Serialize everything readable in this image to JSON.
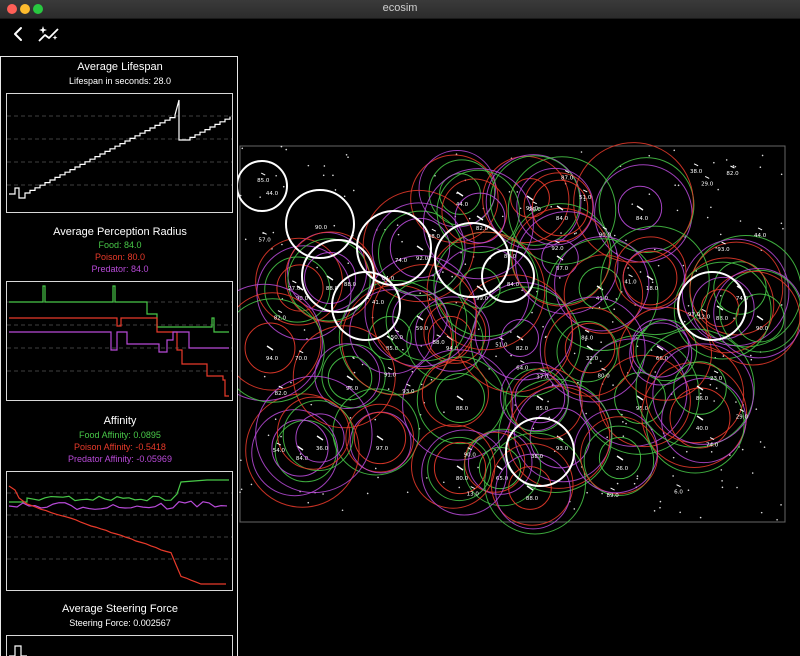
{
  "window": {
    "title": "ecosim"
  },
  "toolbar": {
    "back_icon": "chevron-left-icon",
    "stats_icon": "sparkle-chart-icon"
  },
  "colors": {
    "food": "#48c848",
    "poison": "#e83a2a",
    "predator": "#b84ad8",
    "white": "#ffffff"
  },
  "panel": {
    "lifespan": {
      "title": "Average Lifespan",
      "subtitle": "Lifespan in seconds: 28.0"
    },
    "perception": {
      "title": "Average Perception Radius",
      "food": "Food: 84.0",
      "poison": "Poison: 80.0",
      "predator": "Predator: 84.0"
    },
    "affinity": {
      "title": "Affinity",
      "food": "Food Affinity: 0.0895",
      "poison": "Poison Affinity: -0.5418",
      "predator": "Predator Affinity: -0.05969"
    },
    "steering": {
      "title": "Average Steering Force",
      "subtitle": "Steering Force: 0.002567"
    }
  },
  "simulation": {
    "creature_labels": [
      "44.0",
      "90.0",
      "84.0",
      "74.0",
      "88.0",
      "87.0",
      "41.0",
      "90.0",
      "88.0",
      "85.0",
      "94.0",
      "82.0",
      "95.0",
      "40.0",
      "93.0",
      "88.0",
      "97.0",
      "84.0",
      "65.0",
      "88.0",
      "92.0",
      "99.0",
      "32.0",
      "68.0",
      "96.0",
      "80.0",
      "85.0",
      "26.0",
      "94.0",
      "36.0",
      "86.0",
      "84.0",
      "59.0",
      "90.0",
      "18.0",
      "82.0",
      "90.0",
      "85.0",
      "89.0",
      "74.0",
      "29.0",
      "37.0",
      "27.0",
      "51.0",
      "64.0",
      "84.0",
      "41.0",
      "38.0",
      "82.0",
      "44.0",
      "57.0",
      "82.0",
      "80.0",
      "90.0",
      "54.0",
      "12.0",
      "48.0",
      "51.0",
      "93.0",
      "70.0",
      "82.0",
      "93.0",
      "87.0",
      "23.0",
      "91.0",
      "88.0",
      "13.0",
      "6.0",
      "29.0",
      "50.0",
      "26.0",
      "92.0"
    ]
  }
}
